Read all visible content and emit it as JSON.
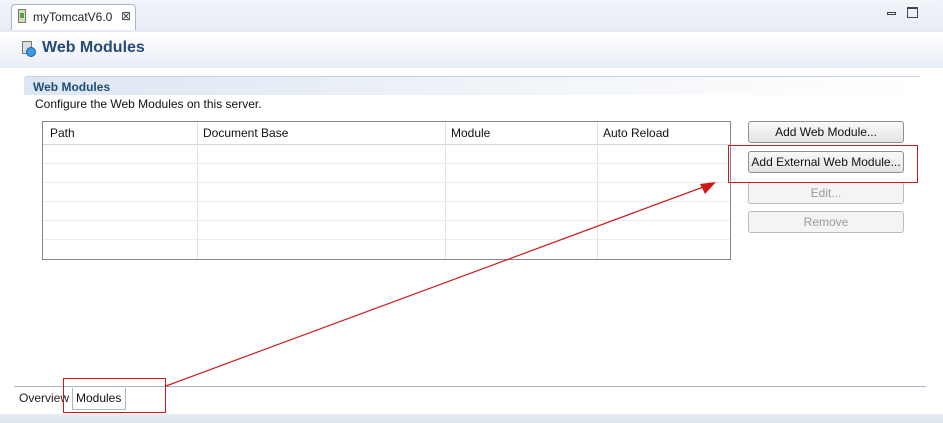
{
  "editor_tab": {
    "title": "myTomcatV6.0",
    "close_glyph": "⊠",
    "icon": "server-config-file-icon"
  },
  "window_controls": {
    "minimize_icon": "minimize-icon",
    "maximize_icon": "maximize-icon"
  },
  "header": {
    "title": "Web Modules",
    "icon": "web-module-icon"
  },
  "section": {
    "title": "Web Modules",
    "description": "Configure the Web Modules on this server."
  },
  "table": {
    "columns": [
      "Path",
      "Document Base",
      "Module",
      "Auto Reload"
    ],
    "rows": []
  },
  "buttons": {
    "add_web_module": "Add Web Module...",
    "add_external_web_module": "Add External Web Module...",
    "edit": "Edit...",
    "remove": "Remove"
  },
  "page_tabs": [
    "Overview",
    "Modules"
  ],
  "annotations": {
    "color": "#d01818"
  },
  "colors": {
    "header_title": "#274a76",
    "section_title": "#1d4d7c"
  }
}
